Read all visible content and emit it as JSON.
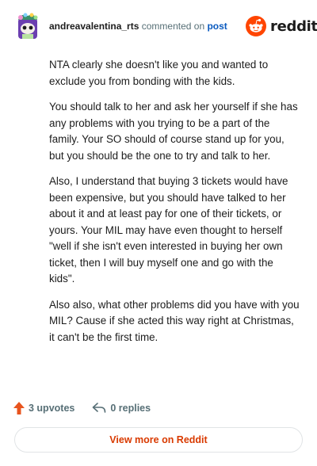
{
  "header": {
    "username": "andreavalentina_rts",
    "action": "commented on",
    "post_link": "post",
    "brand": "reddit"
  },
  "comment": {
    "paragraphs": [
      "NTA clearly she doesn't like you and wanted to exclude you from bonding with the kids.",
      "You should talk to her and ask her yourself if she has any problems with you trying to be a part of the family. Your SO should of course stand up for you, but you should be the one to try and talk to her.",
      "Also, I understand that buying 3 tickets would have been expensive, but you should have talked to her about it and at least pay for one of their tickets, or yours. Your MIL may have even thought to herself \"well if she isn't even interested in buying her own ticket, then I will buy myself one and go with the kids\".",
      "Also also, what other problems did you have with you MIL? Cause if she acted this way right at Christmas, it can't be the first time."
    ]
  },
  "footer": {
    "upvotes": "3 upvotes",
    "replies": "0 replies"
  },
  "view_more": "View more on Reddit",
  "colors": {
    "reddit_orange": "#ff4500",
    "upvote": "#e8541e",
    "link_blue": "#0a5abf",
    "view_more_text": "#d93a00",
    "muted": "#576f76"
  },
  "icons": {
    "avatar": "snoo-avatar-icon",
    "logo": "reddit-logo-icon",
    "upvote": "upvote-arrow-icon",
    "reply": "reply-arrow-icon"
  }
}
